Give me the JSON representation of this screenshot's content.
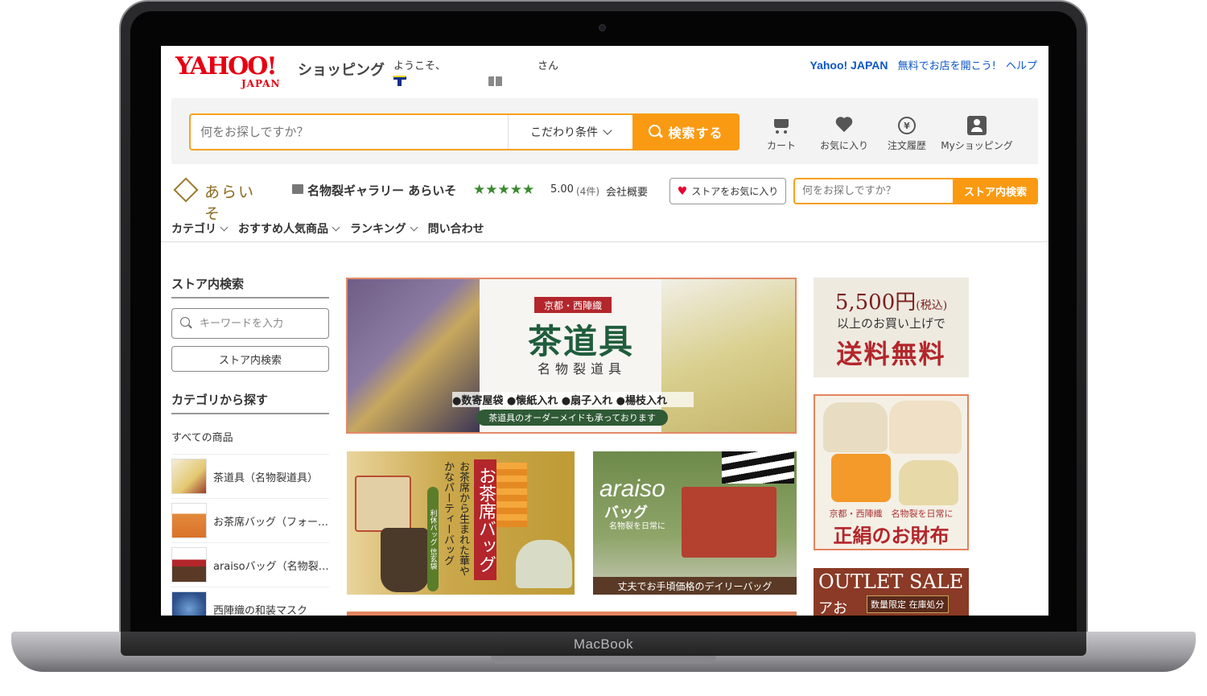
{
  "device": {
    "brand": "MacBook"
  },
  "header": {
    "logo": {
      "main": "YAHOO!",
      "sub": "JAPAN"
    },
    "service": "ショッピング",
    "welcome": "ようこそ、",
    "honorific": "さん",
    "links": [
      "Yahoo! JAPAN",
      "無料でお店を開こう!",
      "ヘルプ"
    ]
  },
  "search": {
    "placeholder": "何をお探しですか？",
    "conditions": "こだわり条件",
    "button": "検索する"
  },
  "nav_icons": [
    {
      "icon": "cart-icon",
      "label": "カート"
    },
    {
      "icon": "heart-icon",
      "label": "お気に入り"
    },
    {
      "icon": "order-history-icon",
      "label": "注文履歴"
    },
    {
      "icon": "person-icon",
      "label": "Myショッピング"
    }
  ],
  "store": {
    "logo_text": "あらいそ",
    "name": "名物裂ギャラリー あらいそ",
    "stars": "★★★★★",
    "rating": "5.00",
    "review_count": "(4件)",
    "company_link": "会社概要",
    "favorite_button": "ストアをお気に入り",
    "search_placeholder": "何をお探しですか？",
    "search_button": "ストア内検索",
    "nav": [
      "カテゴリ",
      "おすすめ人気商品",
      "ランキング",
      "問い合わせ"
    ]
  },
  "sidebar": {
    "search_title": "ストア内検索",
    "keyword_placeholder": "キーワードを入力",
    "search_button": "ストア内検索",
    "category_title": "カテゴリから探す",
    "all_items": "すべての商品",
    "categories": [
      {
        "label": "茶道具（名物裂道具）"
      },
      {
        "label": "お茶席バッグ（フォーマルバッグ）"
      },
      {
        "label": "araisoバッグ（名物裂バッグ）"
      },
      {
        "label": "西陣織の和装マスク"
      }
    ]
  },
  "banners": {
    "main": {
      "tag": "京都・西陣織",
      "title": "茶道具",
      "subtitle": "名物裂道具",
      "bullets": "●数寄屋袋 ●懐紙入れ ●扇子入れ ●楊枝入れ",
      "note": "茶道具のオーダーメイドも承っております"
    },
    "tea_bag": {
      "red_label": "お茶席バッグ",
      "vertical": "お茶席から生まれた華やかなパーティーバッグ",
      "green_label": "利休バッグ 信玄袋"
    },
    "araiso": {
      "title": "araiso",
      "subtitle": "バッグ",
      "caption": "名物裂を日常に",
      "bottom": "丈夫でお手頃価格のデイリーバッグ"
    },
    "shipping": {
      "price": "5,500円",
      "tax": "(税込)",
      "line": "以上のお買い上げで",
      "free": "送料無料"
    },
    "wallet": {
      "small": "京都・西陣織　名物裂を日常に",
      "big": "正絹のお財布"
    },
    "outlet": {
      "title": "OUTLET SALE",
      "left": "アお",
      "tags": "数量限定  在庫処分"
    }
  }
}
